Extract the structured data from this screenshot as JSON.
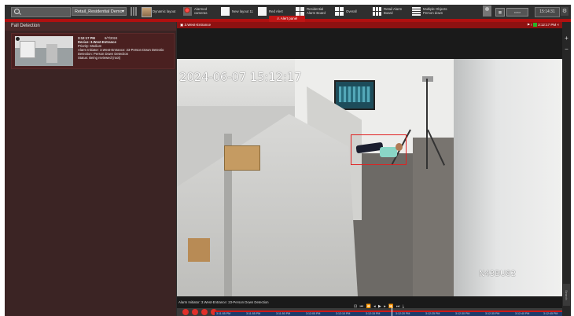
{
  "toolbar": {
    "search_placeholder": "",
    "layout_select": "Retail_Residential Demo",
    "items": [
      {
        "label": "Dynamic layout",
        "icon": "dynamic-layout-icon"
      },
      {
        "label": "Alarmed cameras",
        "icon": "alarm-icon"
      },
      {
        "label": "New layout 11",
        "icon": "layout-icon"
      },
      {
        "label": "Red Alert",
        "icon": "layout-icon"
      },
      {
        "label": "Residential Alarm Board",
        "icon": "grid-icon"
      },
      {
        "label": "Overall",
        "icon": "grid-icon"
      },
      {
        "label": "Retail Alarm Board",
        "icon": "quad-icon"
      },
      {
        "label": "Multiple Objects Person down",
        "icon": "multi-icon"
      }
    ],
    "clock": "15:14:31",
    "alert_tab": "Alert panel"
  },
  "left_panel": {
    "title": "Fall Detection",
    "card": {
      "time": "3:12:17 PM",
      "date": "6/7/2024",
      "device": "Device: 3.West-Entrance",
      "priority": "Priority: Medium",
      "initiator": "Alarm Initiator: 3.West-Entrance: 23-Person Down Detectio",
      "detection": "Detection: Person Down Detection",
      "status": "Status: Being reviewed (root)"
    }
  },
  "camera": {
    "name": "3.West-Entrance",
    "header_time": "3:12:17 PM",
    "overlay_timestamp": "2024-06-07 15:12:17",
    "overlay_label": "N43BU82",
    "alarm_caption": "Alarm Initiator: 3.West-Entrance: 23-Person Down Detection",
    "side_tab": "Search"
  },
  "timeline": {
    "ticks": [
      "3:11:55 PM",
      "3:11:55 PM",
      "3:11:50 PM",
      "3:12:05 PM",
      "3:12:10 PM",
      "3:12:15 PM",
      "3:12:20 PM",
      "3:12:25 PM",
      "3:12:30 PM",
      "3:12:35 PM",
      "3:12:40 PM",
      "3:12:45 PM"
    ]
  },
  "colors": {
    "alert_red": "#b01010",
    "panel_bg": "#3b2424",
    "timeline_blue": "#1e3a6a"
  }
}
